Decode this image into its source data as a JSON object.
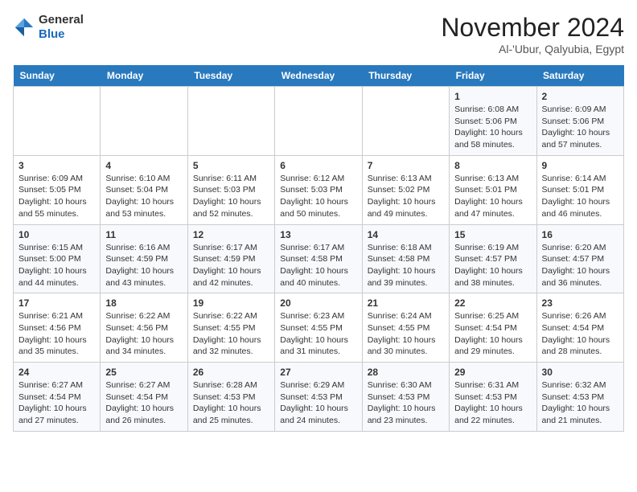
{
  "header": {
    "logo_general": "General",
    "logo_blue": "Blue",
    "month": "November 2024",
    "location": "Al-'Ubur, Qalyubia, Egypt"
  },
  "weekdays": [
    "Sunday",
    "Monday",
    "Tuesday",
    "Wednesday",
    "Thursday",
    "Friday",
    "Saturday"
  ],
  "weeks": [
    [
      {
        "day": "",
        "info": ""
      },
      {
        "day": "",
        "info": ""
      },
      {
        "day": "",
        "info": ""
      },
      {
        "day": "",
        "info": ""
      },
      {
        "day": "",
        "info": ""
      },
      {
        "day": "1",
        "info": "Sunrise: 6:08 AM\nSunset: 5:06 PM\nDaylight: 10 hours\nand 58 minutes."
      },
      {
        "day": "2",
        "info": "Sunrise: 6:09 AM\nSunset: 5:06 PM\nDaylight: 10 hours\nand 57 minutes."
      }
    ],
    [
      {
        "day": "3",
        "info": "Sunrise: 6:09 AM\nSunset: 5:05 PM\nDaylight: 10 hours\nand 55 minutes."
      },
      {
        "day": "4",
        "info": "Sunrise: 6:10 AM\nSunset: 5:04 PM\nDaylight: 10 hours\nand 53 minutes."
      },
      {
        "day": "5",
        "info": "Sunrise: 6:11 AM\nSunset: 5:03 PM\nDaylight: 10 hours\nand 52 minutes."
      },
      {
        "day": "6",
        "info": "Sunrise: 6:12 AM\nSunset: 5:03 PM\nDaylight: 10 hours\nand 50 minutes."
      },
      {
        "day": "7",
        "info": "Sunrise: 6:13 AM\nSunset: 5:02 PM\nDaylight: 10 hours\nand 49 minutes."
      },
      {
        "day": "8",
        "info": "Sunrise: 6:13 AM\nSunset: 5:01 PM\nDaylight: 10 hours\nand 47 minutes."
      },
      {
        "day": "9",
        "info": "Sunrise: 6:14 AM\nSunset: 5:01 PM\nDaylight: 10 hours\nand 46 minutes."
      }
    ],
    [
      {
        "day": "10",
        "info": "Sunrise: 6:15 AM\nSunset: 5:00 PM\nDaylight: 10 hours\nand 44 minutes."
      },
      {
        "day": "11",
        "info": "Sunrise: 6:16 AM\nSunset: 4:59 PM\nDaylight: 10 hours\nand 43 minutes."
      },
      {
        "day": "12",
        "info": "Sunrise: 6:17 AM\nSunset: 4:59 PM\nDaylight: 10 hours\nand 42 minutes."
      },
      {
        "day": "13",
        "info": "Sunrise: 6:17 AM\nSunset: 4:58 PM\nDaylight: 10 hours\nand 40 minutes."
      },
      {
        "day": "14",
        "info": "Sunrise: 6:18 AM\nSunset: 4:58 PM\nDaylight: 10 hours\nand 39 minutes."
      },
      {
        "day": "15",
        "info": "Sunrise: 6:19 AM\nSunset: 4:57 PM\nDaylight: 10 hours\nand 38 minutes."
      },
      {
        "day": "16",
        "info": "Sunrise: 6:20 AM\nSunset: 4:57 PM\nDaylight: 10 hours\nand 36 minutes."
      }
    ],
    [
      {
        "day": "17",
        "info": "Sunrise: 6:21 AM\nSunset: 4:56 PM\nDaylight: 10 hours\nand 35 minutes."
      },
      {
        "day": "18",
        "info": "Sunrise: 6:22 AM\nSunset: 4:56 PM\nDaylight: 10 hours\nand 34 minutes."
      },
      {
        "day": "19",
        "info": "Sunrise: 6:22 AM\nSunset: 4:55 PM\nDaylight: 10 hours\nand 32 minutes."
      },
      {
        "day": "20",
        "info": "Sunrise: 6:23 AM\nSunset: 4:55 PM\nDaylight: 10 hours\nand 31 minutes."
      },
      {
        "day": "21",
        "info": "Sunrise: 6:24 AM\nSunset: 4:55 PM\nDaylight: 10 hours\nand 30 minutes."
      },
      {
        "day": "22",
        "info": "Sunrise: 6:25 AM\nSunset: 4:54 PM\nDaylight: 10 hours\nand 29 minutes."
      },
      {
        "day": "23",
        "info": "Sunrise: 6:26 AM\nSunset: 4:54 PM\nDaylight: 10 hours\nand 28 minutes."
      }
    ],
    [
      {
        "day": "24",
        "info": "Sunrise: 6:27 AM\nSunset: 4:54 PM\nDaylight: 10 hours\nand 27 minutes."
      },
      {
        "day": "25",
        "info": "Sunrise: 6:27 AM\nSunset: 4:54 PM\nDaylight: 10 hours\nand 26 minutes."
      },
      {
        "day": "26",
        "info": "Sunrise: 6:28 AM\nSunset: 4:53 PM\nDaylight: 10 hours\nand 25 minutes."
      },
      {
        "day": "27",
        "info": "Sunrise: 6:29 AM\nSunset: 4:53 PM\nDaylight: 10 hours\nand 24 minutes."
      },
      {
        "day": "28",
        "info": "Sunrise: 6:30 AM\nSunset: 4:53 PM\nDaylight: 10 hours\nand 23 minutes."
      },
      {
        "day": "29",
        "info": "Sunrise: 6:31 AM\nSunset: 4:53 PM\nDaylight: 10 hours\nand 22 minutes."
      },
      {
        "day": "30",
        "info": "Sunrise: 6:32 AM\nSunset: 4:53 PM\nDaylight: 10 hours\nand 21 minutes."
      }
    ]
  ]
}
